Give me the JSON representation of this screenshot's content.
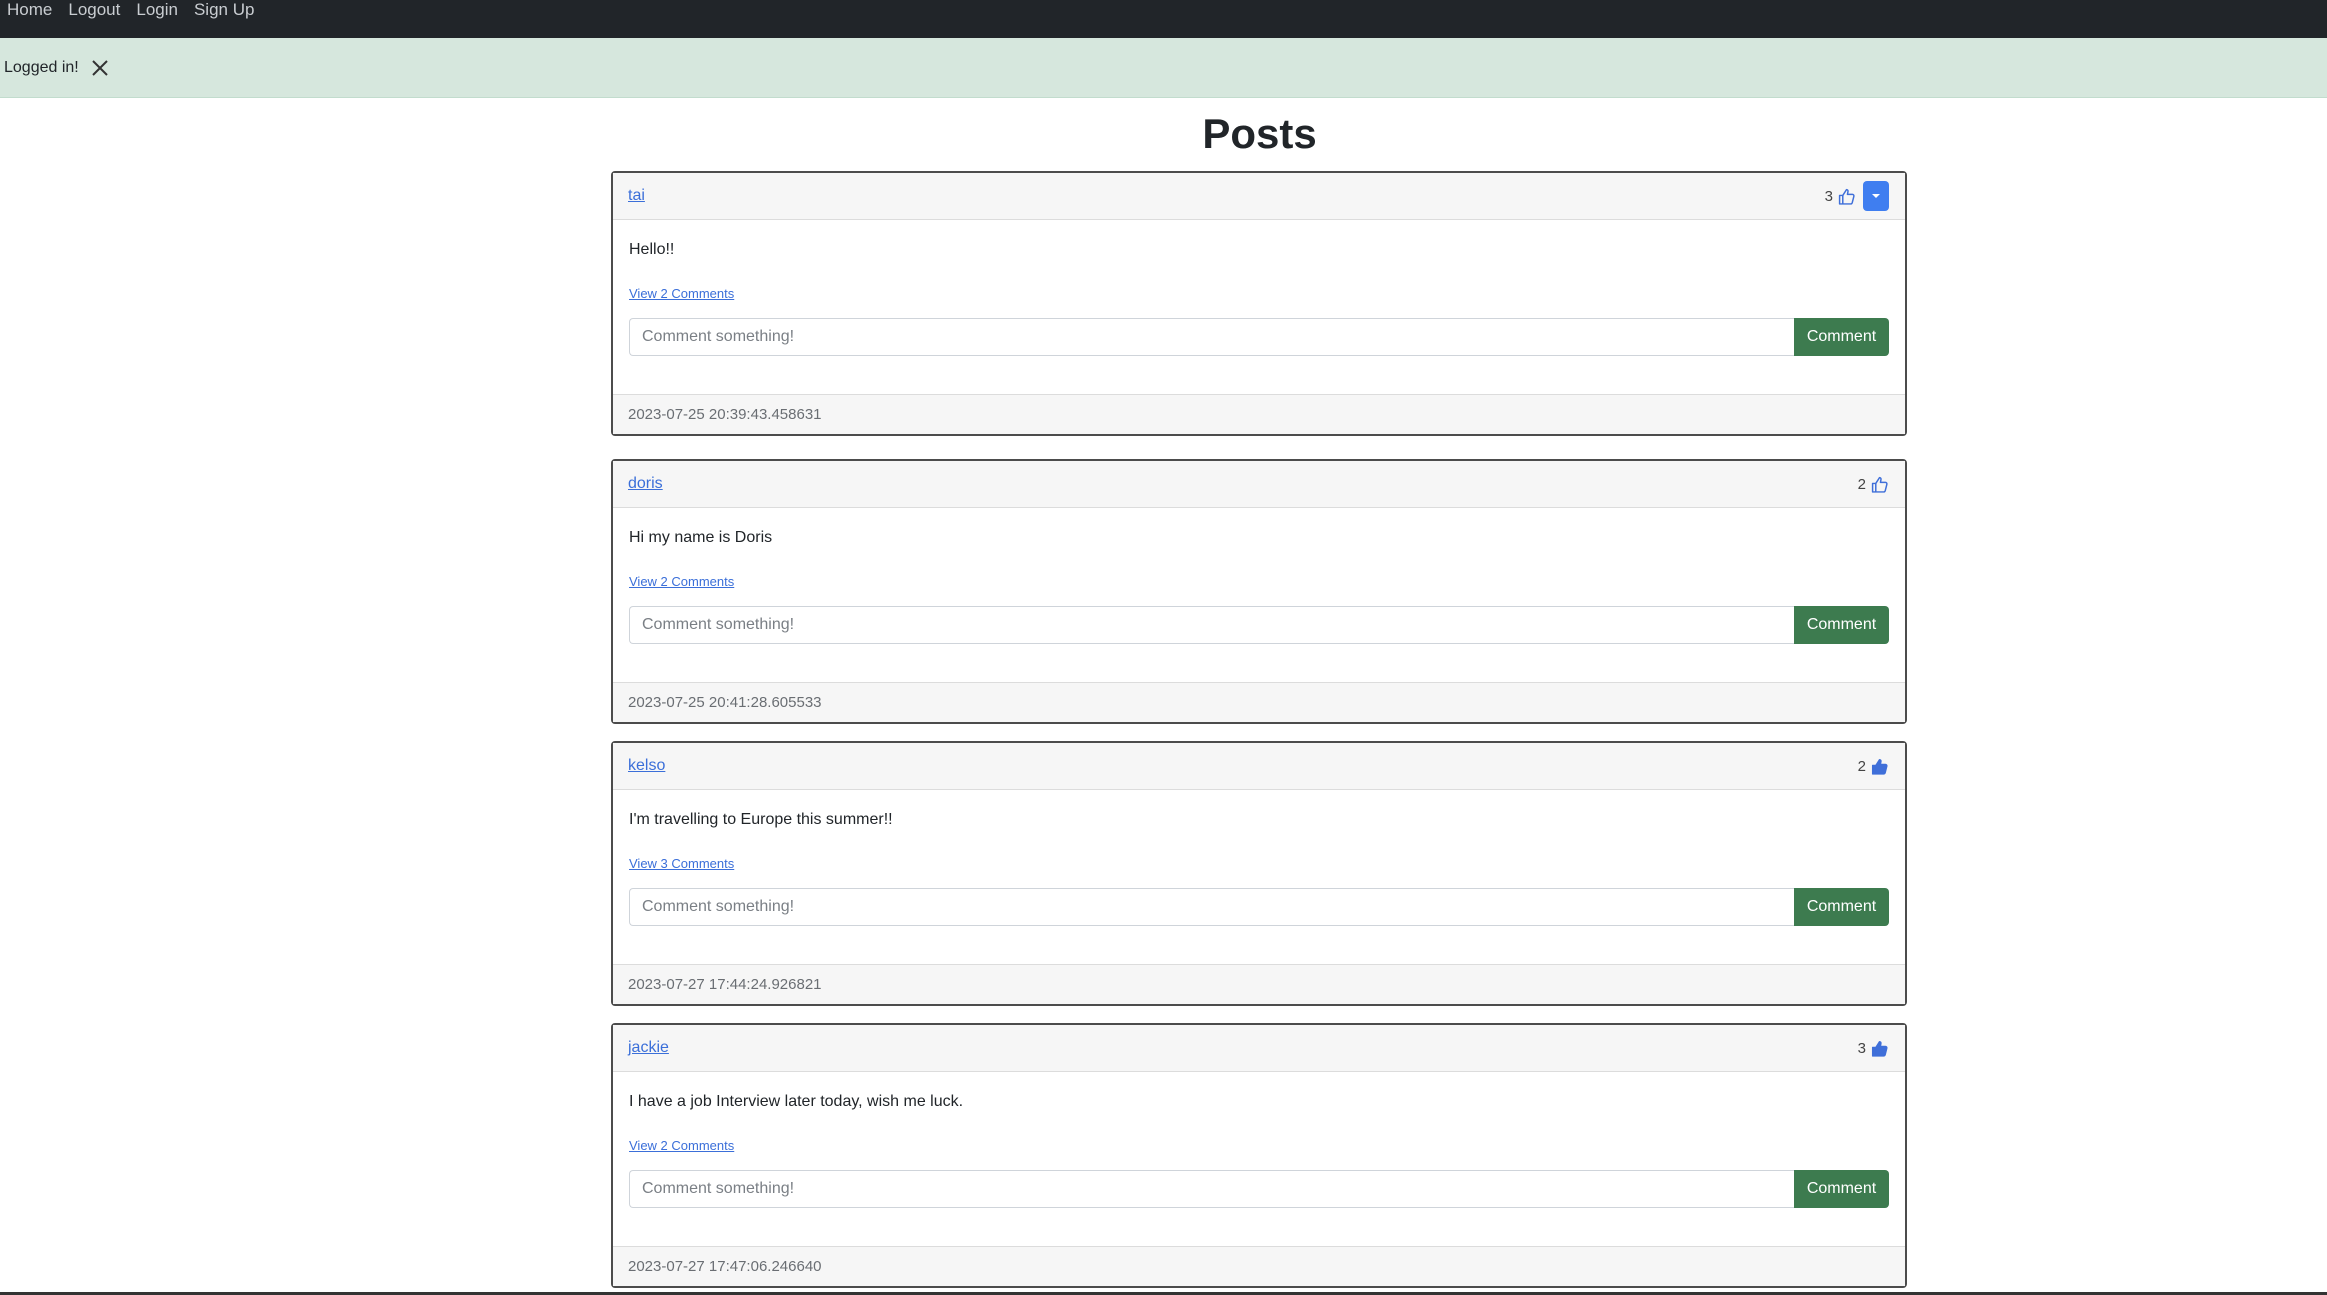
{
  "navbar": {
    "links": [
      "Home",
      "Logout",
      "Login",
      "Sign Up"
    ]
  },
  "alert": {
    "message": "Logged in!",
    "close_icon": "close-icon"
  },
  "page": {
    "title": "Posts"
  },
  "comment_input_placeholder": "Comment something!",
  "comment_button_label": "Comment",
  "posts": [
    {
      "author": "tai",
      "likes": "3",
      "liked": false,
      "has_menu": true,
      "text": "Hello!!",
      "comments_link": "View 2 Comments",
      "timestamp": "2023-07-25 20:39:43.458631"
    },
    {
      "author": "doris",
      "likes": "2",
      "liked": false,
      "has_menu": false,
      "text": "Hi my name is Doris",
      "comments_link": "View 2 Comments",
      "timestamp": "2023-07-25 20:41:28.605533"
    },
    {
      "author": "kelso",
      "likes": "2",
      "liked": true,
      "has_menu": false,
      "text": "I'm travelling to Europe this summer!!",
      "comments_link": "View 3 Comments",
      "timestamp": "2023-07-27 17:44:24.926821"
    },
    {
      "author": "jackie",
      "likes": "3",
      "liked": true,
      "has_menu": false,
      "text": "I have a job Interview later today, wish me luck.",
      "comments_link": "View 2 Comments",
      "timestamp": "2023-07-27 17:47:06.246640"
    }
  ],
  "colors": {
    "navbar_bg": "#212529",
    "alert_bg": "#d6e7dd",
    "link": "#3b6fd9",
    "comment_button": "#3d7b4f",
    "dropdown_button": "#3f7ef0"
  }
}
